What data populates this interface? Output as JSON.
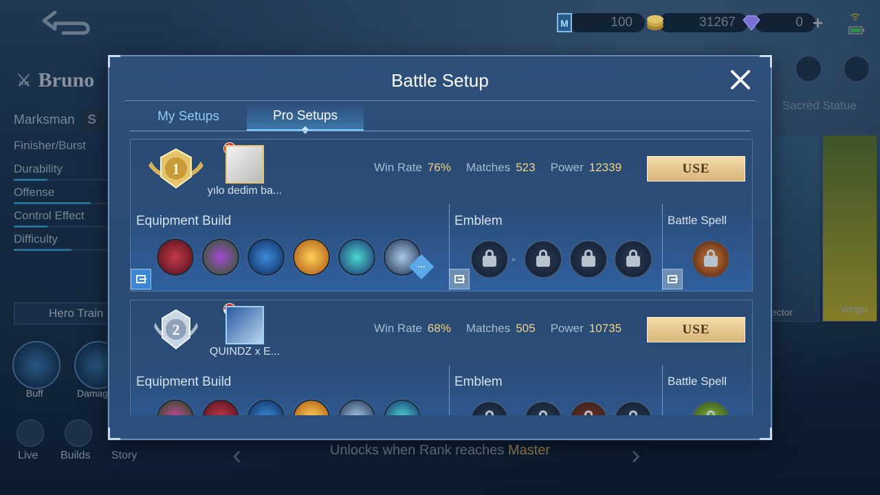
{
  "hero": {
    "name": "Bruno",
    "role": "Marksman",
    "stats": [
      {
        "label": "Finisher/Burst",
        "value": 0.0
      },
      {
        "label": "Durability",
        "value": 0.35
      },
      {
        "label": "Offense",
        "value": 0.8
      },
      {
        "label": "Control Effect",
        "value": 0.35
      },
      {
        "label": "Difficulty",
        "value": 0.6
      }
    ],
    "hero_train_label": "Hero Train",
    "skills": [
      "Buff",
      "Damag"
    ],
    "bottom_nav": [
      "Live",
      "Builds",
      "Story"
    ]
  },
  "currency": {
    "ticket": "100",
    "gold": "31267",
    "diamond": "0"
  },
  "right_panel": {
    "sacred_statue": "Sacred Statue",
    "cards": [
      "ector",
      "Vangu"
    ]
  },
  "rank_hint": {
    "prefix": "Unlocks when Rank reaches ",
    "rank": "Master"
  },
  "modal": {
    "title": "Battle Setup",
    "tabs": [
      {
        "label": "My Setups",
        "active": false
      },
      {
        "label": "Pro Setups",
        "active": true
      }
    ],
    "labels": {
      "win_rate": "Win Rate",
      "matches": "Matches",
      "power": "Power",
      "use": "USE",
      "equipment_build": "Equipment Build",
      "emblem": "Emblem",
      "battle_spell": "Battle Spell"
    },
    "entries": [
      {
        "rank": "1",
        "player": "yılo dedim ba...",
        "win_rate": "76%",
        "matches": "523",
        "power": "12339"
      },
      {
        "rank": "2",
        "player": "QUINDZ x E...",
        "win_rate": "68%",
        "matches": "505",
        "power": "10735"
      }
    ]
  },
  "colors": {
    "accent": "#7fd0ff",
    "value_gold": "#f0d48a",
    "use_button": "#e6c68f"
  },
  "icons": [
    "back-arrow-icon",
    "close-icon",
    "lock-icon",
    "copy-icon",
    "more-icon",
    "ticket-icon",
    "gold-coin-icon",
    "diamond-icon",
    "plus-icon",
    "wifi-icon",
    "battery-icon"
  ]
}
